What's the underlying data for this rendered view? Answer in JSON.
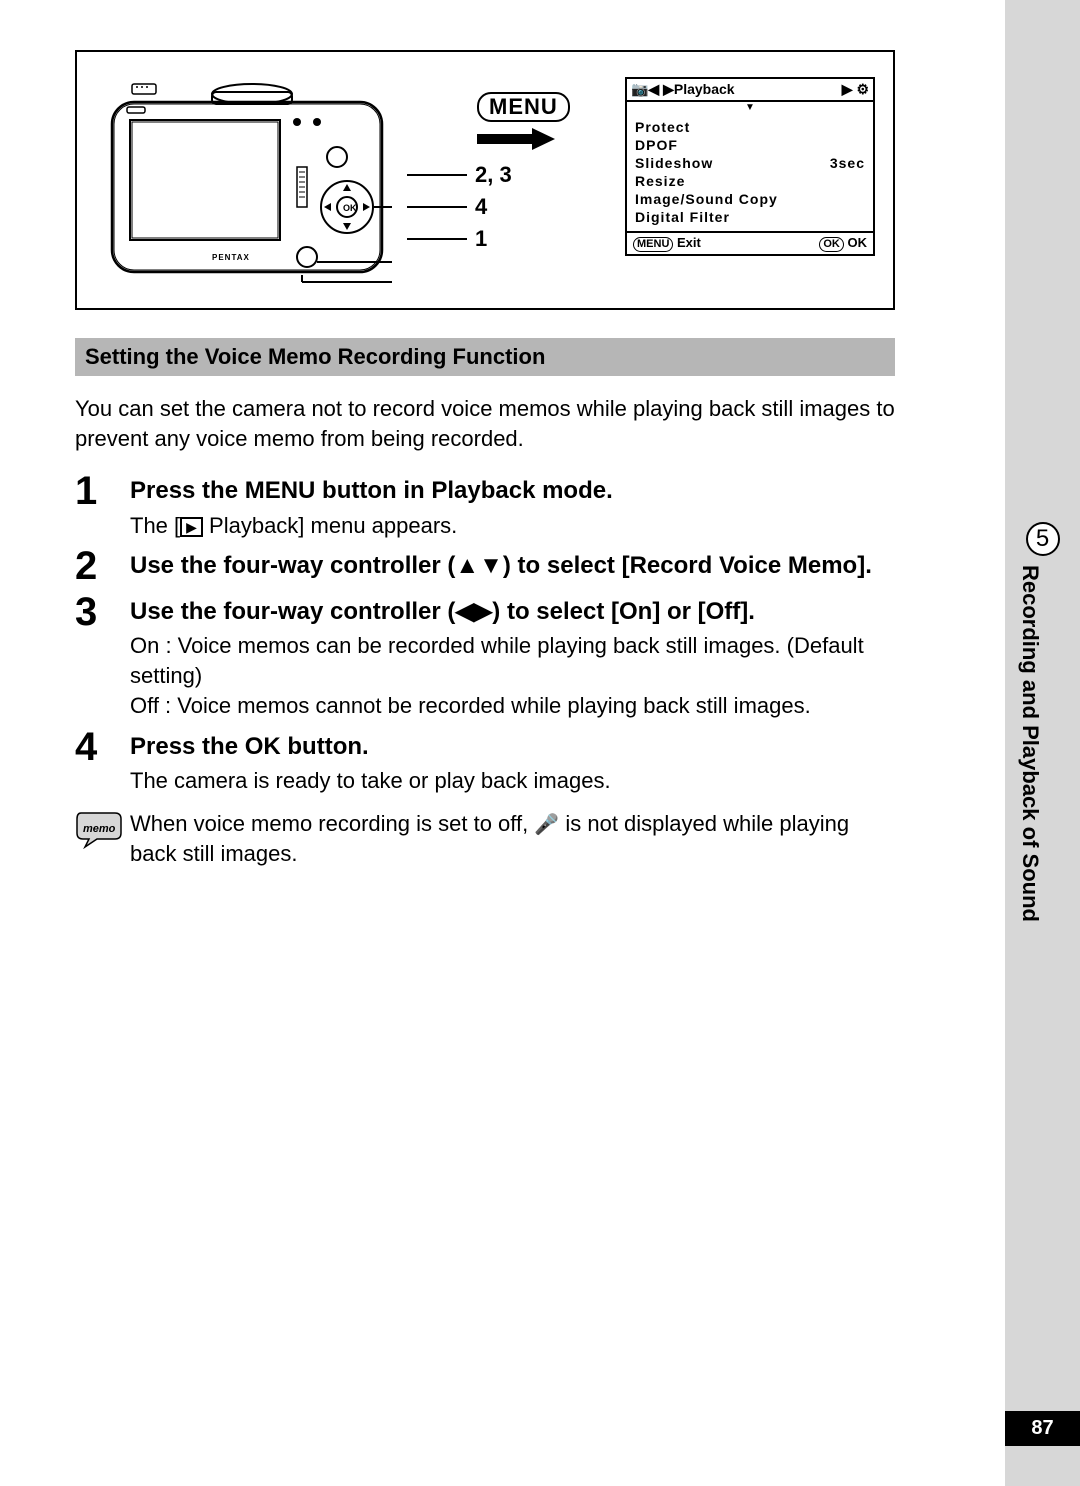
{
  "sidebar": {
    "chapter_number": "5",
    "chapter_title": "Recording and Playback of Sound",
    "page_number": "87"
  },
  "figure": {
    "menu_button_label": "MENU",
    "callout_23": "2, 3",
    "callout_4": "4",
    "callout_1": "1",
    "menu_screen": {
      "tab_left": "📷◀ ▶Playback",
      "tab_right": "▶ ⚙",
      "items": [
        {
          "label": "Protect",
          "value": ""
        },
        {
          "label": "DPOF",
          "value": ""
        },
        {
          "label": "Slideshow",
          "value": "3sec"
        },
        {
          "label": "Resize",
          "value": ""
        },
        {
          "label": "Image/Sound Copy",
          "value": ""
        },
        {
          "label": "Digital Filter",
          "value": ""
        }
      ],
      "foot_left_btn": "MENU",
      "foot_left_label": "Exit",
      "foot_right_btn": "OK",
      "foot_right_label": "OK"
    }
  },
  "section_title": "Setting the Voice Memo Recording Function",
  "intro_text": "You can set the camera not to record voice memos while playing back still images to prevent any voice memo from being recorded.",
  "steps": {
    "s1": {
      "num": "1",
      "title": "Press the MENU button in Playback mode.",
      "desc_a": "The [",
      "desc_b": " Playback] menu appears."
    },
    "s2": {
      "num": "2",
      "title": "Use the four-way controller (▲▼) to select [Record Voice Memo]."
    },
    "s3": {
      "num": "3",
      "title": "Use the four-way controller (◀▶) to select [On] or [Off].",
      "desc_on": "On : Voice memos can be recorded while playing back still images. (Default setting)",
      "desc_off": "Off : Voice memos cannot be recorded while playing back still images."
    },
    "s4": {
      "num": "4",
      "title": "Press the OK button.",
      "desc": "The camera is ready to take or play back images."
    }
  },
  "memo": {
    "text_a": "When voice memo recording is set to off, ",
    "text_b": " is not displayed while playing back still images."
  }
}
